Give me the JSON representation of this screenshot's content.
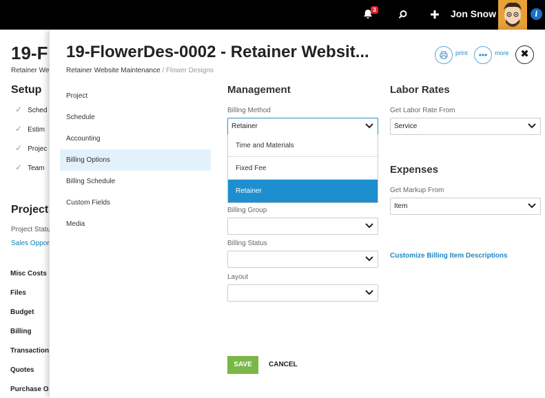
{
  "topbar": {
    "notification_count": "3",
    "username": "Jon Snow",
    "info_glyph": "i",
    "icons": [
      "bell-icon",
      "search-icon",
      "plus-icon",
      "avatar",
      "info-icon"
    ]
  },
  "background_page": {
    "title": "19-F",
    "subtitle": "Retainer We",
    "setup_heading": "Setup",
    "setup_items": [
      "Sched",
      "Estim",
      "Projec",
      "Team"
    ],
    "project_heading": "Project",
    "project_status_label": "Project Statu",
    "project_status_value": "Sales Oppor",
    "links": [
      "Misc Costs",
      "Files",
      "Budget",
      "Billing",
      "Transaction",
      "Quotes",
      "Purchase O"
    ]
  },
  "panel": {
    "title": "19-FlowerDes-0002 - Retainer Websit...",
    "breadcrumb_main": "Retainer Website Maintenance",
    "breadcrumb_sep": " / ",
    "breadcrumb_sub": "Flower Designs",
    "print_label": "print",
    "more_label": "more",
    "close_glyph": "✖"
  },
  "nav": {
    "items": [
      "Project",
      "Schedule",
      "Accounting",
      "Billing Options",
      "Billing Schedule",
      "Custom Fields",
      "Media"
    ],
    "active": "Billing Options"
  },
  "management": {
    "heading": "Management",
    "billing_method_label": "Billing Method",
    "billing_method_value": "Retainer",
    "billing_method_options": [
      "Time and Materials",
      "Fixed Fee",
      "Retainer"
    ],
    "billing_group_label": "Billing Group",
    "billing_group_value": "",
    "billing_status_label": "Billing Status",
    "billing_status_value": "",
    "layout_label": "Layout",
    "layout_value": ""
  },
  "labor_rates": {
    "heading": "Labor Rates",
    "get_rate_from_label": "Get Labor Rate From",
    "get_rate_from_value": "Service"
  },
  "expenses": {
    "heading": "Expenses",
    "get_markup_label": "Get Markup From",
    "get_markup_value": "Item"
  },
  "customize_link": "Customize Billing Item Descriptions",
  "actions": {
    "save": "SAVE",
    "cancel": "CANCEL"
  },
  "colors": {
    "accent": "#1e8fce",
    "save": "#7ab648",
    "link": "#1e88c2",
    "active_nav": "#e3f1fa"
  }
}
